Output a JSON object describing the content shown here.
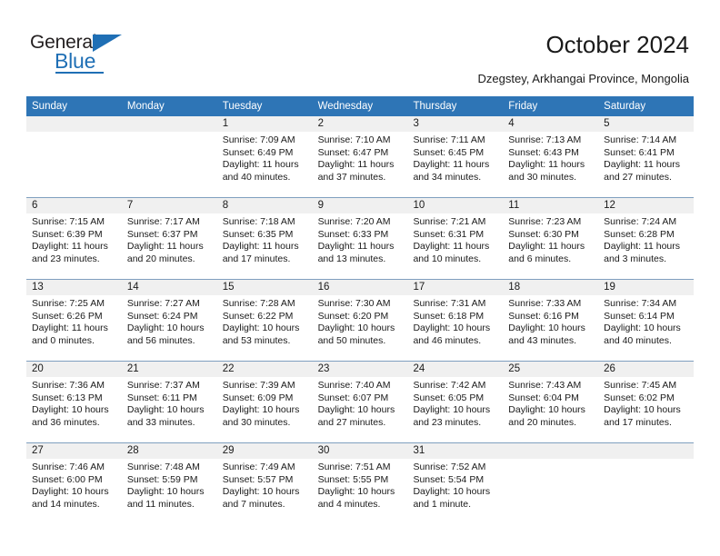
{
  "logo": {
    "text_top": "General",
    "text_bottom": "Blue",
    "brand_color": "#1f6fb5",
    "triangle_icon": "triangle-icon"
  },
  "header": {
    "title": "October 2024",
    "subtitle": "Dzegstey, Arkhangai Province, Mongolia"
  },
  "colors": {
    "header_bar": "#2e75b6",
    "day_band": "#f0f0f0",
    "row_divider": "#7f9fbf",
    "text": "#1a1a1a"
  },
  "weekdays": [
    "Sunday",
    "Monday",
    "Tuesday",
    "Wednesday",
    "Thursday",
    "Friday",
    "Saturday"
  ],
  "weeks": [
    [
      {
        "day": "",
        "lines": []
      },
      {
        "day": "",
        "lines": []
      },
      {
        "day": "1",
        "lines": [
          "Sunrise: 7:09 AM",
          "Sunset: 6:49 PM",
          "Daylight: 11 hours",
          "and 40 minutes."
        ]
      },
      {
        "day": "2",
        "lines": [
          "Sunrise: 7:10 AM",
          "Sunset: 6:47 PM",
          "Daylight: 11 hours",
          "and 37 minutes."
        ]
      },
      {
        "day": "3",
        "lines": [
          "Sunrise: 7:11 AM",
          "Sunset: 6:45 PM",
          "Daylight: 11 hours",
          "and 34 minutes."
        ]
      },
      {
        "day": "4",
        "lines": [
          "Sunrise: 7:13 AM",
          "Sunset: 6:43 PM",
          "Daylight: 11 hours",
          "and 30 minutes."
        ]
      },
      {
        "day": "5",
        "lines": [
          "Sunrise: 7:14 AM",
          "Sunset: 6:41 PM",
          "Daylight: 11 hours",
          "and 27 minutes."
        ]
      }
    ],
    [
      {
        "day": "6",
        "lines": [
          "Sunrise: 7:15 AM",
          "Sunset: 6:39 PM",
          "Daylight: 11 hours",
          "and 23 minutes."
        ]
      },
      {
        "day": "7",
        "lines": [
          "Sunrise: 7:17 AM",
          "Sunset: 6:37 PM",
          "Daylight: 11 hours",
          "and 20 minutes."
        ]
      },
      {
        "day": "8",
        "lines": [
          "Sunrise: 7:18 AM",
          "Sunset: 6:35 PM",
          "Daylight: 11 hours",
          "and 17 minutes."
        ]
      },
      {
        "day": "9",
        "lines": [
          "Sunrise: 7:20 AM",
          "Sunset: 6:33 PM",
          "Daylight: 11 hours",
          "and 13 minutes."
        ]
      },
      {
        "day": "10",
        "lines": [
          "Sunrise: 7:21 AM",
          "Sunset: 6:31 PM",
          "Daylight: 11 hours",
          "and 10 minutes."
        ]
      },
      {
        "day": "11",
        "lines": [
          "Sunrise: 7:23 AM",
          "Sunset: 6:30 PM",
          "Daylight: 11 hours",
          "and 6 minutes."
        ]
      },
      {
        "day": "12",
        "lines": [
          "Sunrise: 7:24 AM",
          "Sunset: 6:28 PM",
          "Daylight: 11 hours",
          "and 3 minutes."
        ]
      }
    ],
    [
      {
        "day": "13",
        "lines": [
          "Sunrise: 7:25 AM",
          "Sunset: 6:26 PM",
          "Daylight: 11 hours",
          "and 0 minutes."
        ]
      },
      {
        "day": "14",
        "lines": [
          "Sunrise: 7:27 AM",
          "Sunset: 6:24 PM",
          "Daylight: 10 hours",
          "and 56 minutes."
        ]
      },
      {
        "day": "15",
        "lines": [
          "Sunrise: 7:28 AM",
          "Sunset: 6:22 PM",
          "Daylight: 10 hours",
          "and 53 minutes."
        ]
      },
      {
        "day": "16",
        "lines": [
          "Sunrise: 7:30 AM",
          "Sunset: 6:20 PM",
          "Daylight: 10 hours",
          "and 50 minutes."
        ]
      },
      {
        "day": "17",
        "lines": [
          "Sunrise: 7:31 AM",
          "Sunset: 6:18 PM",
          "Daylight: 10 hours",
          "and 46 minutes."
        ]
      },
      {
        "day": "18",
        "lines": [
          "Sunrise: 7:33 AM",
          "Sunset: 6:16 PM",
          "Daylight: 10 hours",
          "and 43 minutes."
        ]
      },
      {
        "day": "19",
        "lines": [
          "Sunrise: 7:34 AM",
          "Sunset: 6:14 PM",
          "Daylight: 10 hours",
          "and 40 minutes."
        ]
      }
    ],
    [
      {
        "day": "20",
        "lines": [
          "Sunrise: 7:36 AM",
          "Sunset: 6:13 PM",
          "Daylight: 10 hours",
          "and 36 minutes."
        ]
      },
      {
        "day": "21",
        "lines": [
          "Sunrise: 7:37 AM",
          "Sunset: 6:11 PM",
          "Daylight: 10 hours",
          "and 33 minutes."
        ]
      },
      {
        "day": "22",
        "lines": [
          "Sunrise: 7:39 AM",
          "Sunset: 6:09 PM",
          "Daylight: 10 hours",
          "and 30 minutes."
        ]
      },
      {
        "day": "23",
        "lines": [
          "Sunrise: 7:40 AM",
          "Sunset: 6:07 PM",
          "Daylight: 10 hours",
          "and 27 minutes."
        ]
      },
      {
        "day": "24",
        "lines": [
          "Sunrise: 7:42 AM",
          "Sunset: 6:05 PM",
          "Daylight: 10 hours",
          "and 23 minutes."
        ]
      },
      {
        "day": "25",
        "lines": [
          "Sunrise: 7:43 AM",
          "Sunset: 6:04 PM",
          "Daylight: 10 hours",
          "and 20 minutes."
        ]
      },
      {
        "day": "26",
        "lines": [
          "Sunrise: 7:45 AM",
          "Sunset: 6:02 PM",
          "Daylight: 10 hours",
          "and 17 minutes."
        ]
      }
    ],
    [
      {
        "day": "27",
        "lines": [
          "Sunrise: 7:46 AM",
          "Sunset: 6:00 PM",
          "Daylight: 10 hours",
          "and 14 minutes."
        ]
      },
      {
        "day": "28",
        "lines": [
          "Sunrise: 7:48 AM",
          "Sunset: 5:59 PM",
          "Daylight: 10 hours",
          "and 11 minutes."
        ]
      },
      {
        "day": "29",
        "lines": [
          "Sunrise: 7:49 AM",
          "Sunset: 5:57 PM",
          "Daylight: 10 hours",
          "and 7 minutes."
        ]
      },
      {
        "day": "30",
        "lines": [
          "Sunrise: 7:51 AM",
          "Sunset: 5:55 PM",
          "Daylight: 10 hours",
          "and 4 minutes."
        ]
      },
      {
        "day": "31",
        "lines": [
          "Sunrise: 7:52 AM",
          "Sunset: 5:54 PM",
          "Daylight: 10 hours",
          "and 1 minute."
        ]
      },
      {
        "day": "",
        "lines": []
      },
      {
        "day": "",
        "lines": []
      }
    ]
  ]
}
